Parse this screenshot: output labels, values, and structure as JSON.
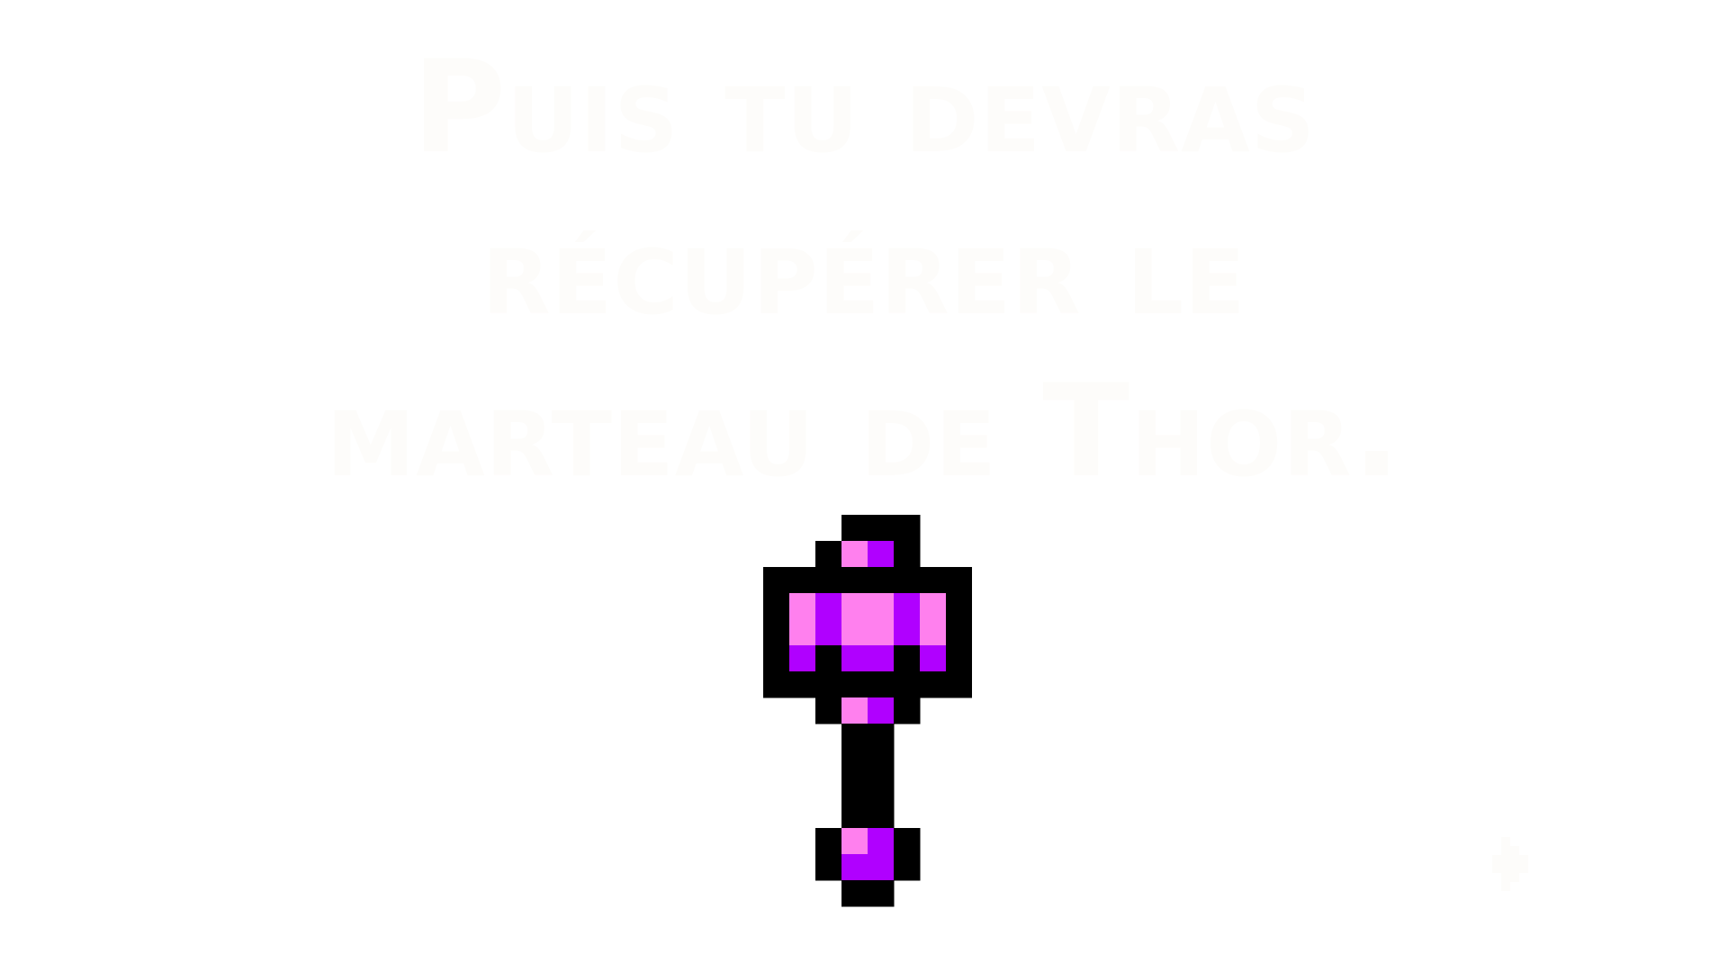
{
  "dialogue": {
    "lines": [
      "Puis tu devras",
      "récupérer le",
      "marteau de Thor."
    ],
    "text_color": "#fdfcfa"
  },
  "hammer": {
    "icon": "pixel-hammer-icon",
    "colors": {
      "outline": "#000000",
      "light": "#ff80ee",
      "dark": "#b000ff"
    }
  },
  "continue_indicator": {
    "icon": "continue-arrow-icon",
    "color": "#fdfcfa"
  },
  "background_color": "#ffffff"
}
